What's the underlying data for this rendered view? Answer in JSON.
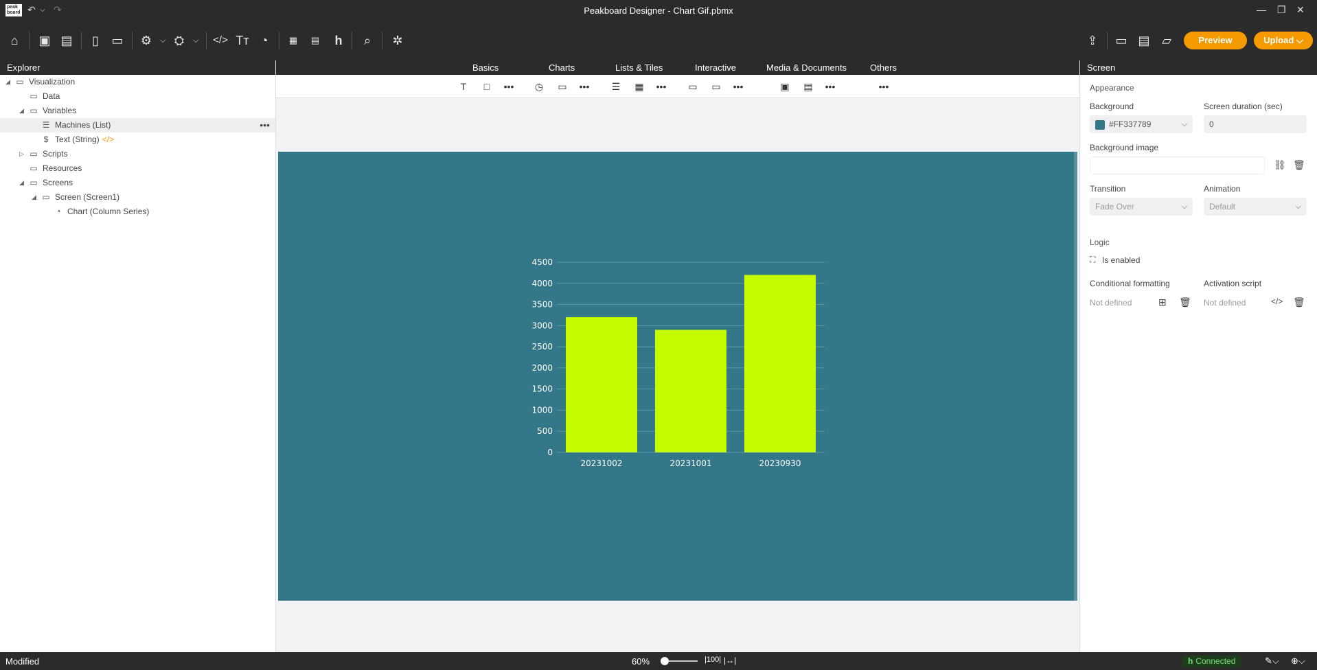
{
  "window": {
    "title": "Peakboard Designer - Chart Gif.pbmx",
    "logo_text": "peak board",
    "minimize": "—",
    "restore": "❐",
    "close": "✕"
  },
  "toolbar": {
    "icons": [
      "home-icon",
      "save-icon",
      "save-all-icon",
      "new-file-icon",
      "open-folder-icon",
      "settings-icon",
      "deploy-icon",
      "script-icon",
      "text-icon",
      "palette-icon",
      "peakboard-box-icon",
      "edge-icon",
      "hub-icon",
      "search-icon",
      "extensions-icon",
      "upload-icon",
      "folder-icon",
      "folder-shared-icon",
      "folder-open-icon"
    ],
    "preview_label": "Preview",
    "upload_label": "Upload ⌵",
    "accent": "#f59a00"
  },
  "explorer": {
    "title": "Explorer",
    "items": [
      {
        "label": "Visualization",
        "icon": "folder-icon"
      },
      {
        "label": "Data",
        "icon": "folder-icon"
      },
      {
        "label": "Variables",
        "icon": "folder-icon"
      },
      {
        "label": "Machines (List)",
        "icon": "list-icon"
      },
      {
        "label": "Text (String)",
        "icon": "string-icon",
        "badge": "</>"
      },
      {
        "label": "Scripts",
        "icon": "folder-icon"
      },
      {
        "label": "Resources",
        "icon": "folder-icon"
      },
      {
        "label": "Screens",
        "icon": "folder-icon"
      },
      {
        "label": "Screen (Screen1)",
        "icon": "screen-icon"
      },
      {
        "label": "Chart (Column Series)",
        "icon": "chart-icon"
      }
    ],
    "more": "•••"
  },
  "center": {
    "tabs": [
      "Basics",
      "Charts",
      "Lists & Tiles",
      "Interactive",
      "Media & Documents",
      "Others"
    ],
    "screen_background": "#337789"
  },
  "chart_data": {
    "type": "bar",
    "categories": [
      "20231002",
      "20231001",
      "20230930"
    ],
    "values": [
      3200,
      2900,
      4200
    ],
    "yticks": [
      "0",
      "500",
      "1000",
      "1500",
      "2000",
      "2500",
      "3000",
      "3500",
      "4000",
      "4500"
    ],
    "ylim": [
      0,
      4500
    ],
    "bar_color": "#c6fb00",
    "grid": true
  },
  "properties": {
    "title": "Screen",
    "appearance": "Appearance",
    "background_label": "Background",
    "background_value": "#FF337789",
    "duration_label": "Screen duration (sec)",
    "duration_value": "0",
    "bg_image_label": "Background image",
    "transition_label": "Transition",
    "transition_value": "Fade Over",
    "animation_label": "Animation",
    "animation_value": "Default",
    "logic": "Logic",
    "is_enabled": "Is enabled",
    "cond_label": "Conditional formatting",
    "cond_value": "Not defined",
    "activation_label": "Activation script",
    "activation_value": "Not defined"
  },
  "status": {
    "left": "Modified",
    "zoom": "60%",
    "connected": "Connected"
  }
}
